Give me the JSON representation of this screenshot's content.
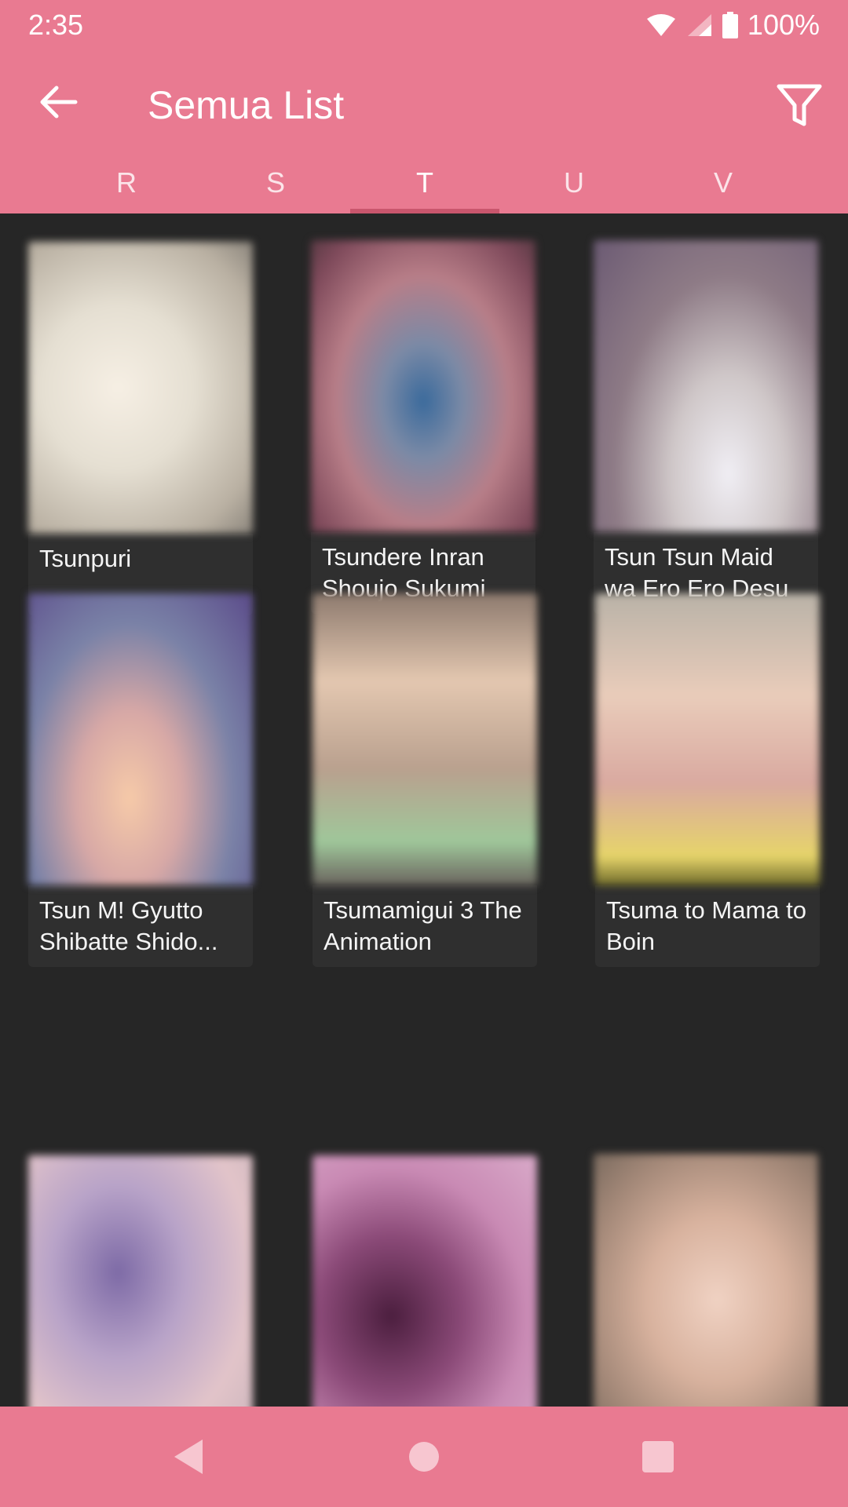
{
  "status_bar": {
    "time": "2:35",
    "battery": "100%",
    "icons": [
      "wifi-icon",
      "signal-icon",
      "battery-icon"
    ]
  },
  "app_bar": {
    "title": "Semua List",
    "back_icon": "arrow-left-icon",
    "filter_icon": "filter-icon"
  },
  "tabs": [
    {
      "label": "R"
    },
    {
      "label": "S"
    },
    {
      "label": "T",
      "active": true
    },
    {
      "label": "U"
    },
    {
      "label": "V"
    }
  ],
  "items": [
    {
      "title": "Tsunpuri"
    },
    {
      "title": "Tsundere Inran Shoujo Sukumi"
    },
    {
      "title": "Tsun Tsun Maid wa Ero Ero Desu"
    },
    {
      "title": "Tsun M! Gyutto Shibatte Shido..."
    },
    {
      "title": "Tsumamigui 3 The Animation"
    },
    {
      "title": "Tsuma to Mama to Boin"
    },
    {
      "title": ""
    },
    {
      "title": ""
    },
    {
      "title": ""
    }
  ],
  "colors": {
    "primary": "#e97a91",
    "background": "#262626",
    "card": "#2f2f2f",
    "tab_indicator": "#c9566d"
  }
}
